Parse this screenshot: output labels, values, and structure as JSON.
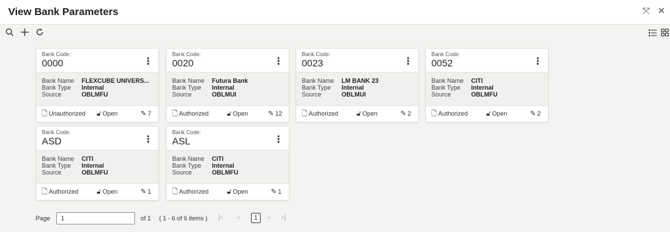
{
  "window": {
    "title": "View Bank Parameters",
    "resize_icon": "resize-icon",
    "close_icon": "close-icon"
  },
  "toolbar": {
    "search_icon": "search-icon",
    "add_icon": "add-icon",
    "refresh_icon": "refresh-icon",
    "list_view_icon": "list-view-icon",
    "grid_view_icon": "grid-view-icon"
  },
  "card_labels": {
    "bank_code": "Bank Code:",
    "bank_name": "Bank Name",
    "bank_type": "Bank Type",
    "source": "Source"
  },
  "cards": [
    {
      "code": "0000",
      "bank_name": "FLEXCUBE UNIVERS...",
      "bank_type": "Internal",
      "source": "OBLMFU",
      "auth_status": "Unauthorized",
      "record_status": "Open",
      "mod_no": "7"
    },
    {
      "code": "0020",
      "bank_name": "Futura Bank",
      "bank_type": "Internal",
      "source": "OBLMUI",
      "auth_status": "Authorized",
      "record_status": "Open",
      "mod_no": "12"
    },
    {
      "code": "0023",
      "bank_name": "LM BANK 23",
      "bank_type": "Internal",
      "source": "OBLMUI",
      "auth_status": "Authorized",
      "record_status": "Open",
      "mod_no": "2"
    },
    {
      "code": "0052",
      "bank_name": "CITI",
      "bank_type": "Internal",
      "source": "OBLMFU",
      "auth_status": "Authorized",
      "record_status": "Open",
      "mod_no": "2"
    },
    {
      "code": "ASD",
      "bank_name": "CITI",
      "bank_type": "Internal",
      "source": "OBLMFU",
      "auth_status": "Authorized",
      "record_status": "Open",
      "mod_no": "1"
    },
    {
      "code": "ASL",
      "bank_name": "CITI",
      "bank_type": "Internal",
      "source": "OBLMFU",
      "auth_status": "Authorized",
      "record_status": "Open",
      "mod_no": "1"
    }
  ],
  "pagination": {
    "page_label": "Page",
    "page_value": "1",
    "of_label": "of 1",
    "items_summary": "( 1 - 6 of 6 items )",
    "current_page": "1"
  }
}
